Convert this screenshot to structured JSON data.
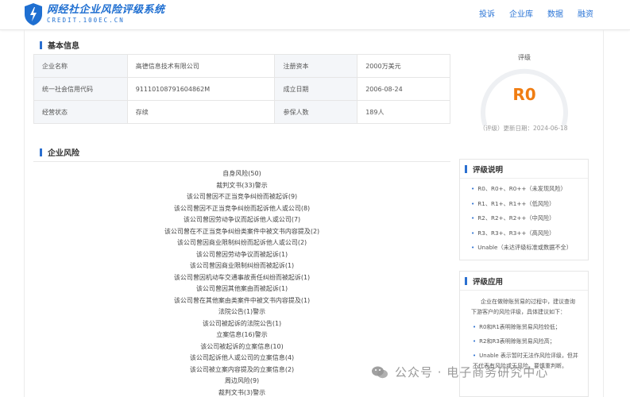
{
  "header": {
    "logo_main": "网经社企业风险评级系统",
    "logo_sub": "CREDIT.100EC.CN",
    "nav": [
      "投诉",
      "企业库",
      "数据",
      "融资"
    ]
  },
  "basic_info": {
    "title": "基本信息",
    "rows": [
      [
        "企业名称",
        "高德信息技术有限公司",
        "注册资本",
        "2000万美元"
      ],
      [
        "统一社会信用代码",
        "91110108791604862M",
        "成立日期",
        "2006-08-24"
      ],
      [
        "经营状态",
        "存续",
        "参保人数",
        "189人"
      ]
    ]
  },
  "rating": {
    "title": "评级",
    "value": "R0",
    "date_line": "（评级）更新日期：2024-06-18",
    "accent_color": "#f07d12"
  },
  "risk": {
    "title": "企业风险",
    "items": [
      "自身风险(50)",
      "裁判文书(33)警示",
      "该公司曾因不正当竞争纠纷而被起诉(9)",
      "该公司曾因不正当竞争纠纷而起诉他人或公司(8)",
      "该公司曾因劳动争议而起诉他人或公司(7)",
      "该公司曾在不正当竞争纠纷类案件中被文书内容提及(2)",
      "该公司曾因商业限制纠纷而起诉他人或公司(2)",
      "该公司曾因劳动争议而被起诉(1)",
      "该公司曾因商业限制纠纷而被起诉(1)",
      "该公司曾因机动车交通事故责任纠纷而被起诉(1)",
      "该公司曾因其他案由而被起诉(1)",
      "该公司曾在其他案由类案件中被文书内容提及(1)",
      "法院公告(1)警示",
      "该公司被起诉的法院公告(1)",
      "立案信息(16)警示",
      "该公司被起诉的立案信息(10)",
      "该公司起诉他人或公司的立案信息(4)",
      "该公司被立案内容提及的立案信息(2)",
      "周边风险(9)",
      "裁判文书(3)警示"
    ]
  },
  "grade_desc": {
    "title": "评级说明",
    "items": [
      "R0、R0+、R0++（未发现风险）",
      "R1、R1+、R1++（低风险）",
      "R2、R2+、R2++（中风险）",
      "R3、R3+、R3++（高风险）",
      "Unable（未达评级标准或数据不全）"
    ]
  },
  "grade_app": {
    "title": "评级应用",
    "intro": "企业在做赊账贸易的过程中，建议查询下游客户的风险评级，具体建议如下：",
    "items": [
      "R0和R1表明赊账贸易风险较低；",
      "R2和R3表明赊账贸易风险高；",
      "Unable 表示暂时无法作风险评级，但并不代表有风险或无风险，要慎重判断。"
    ]
  },
  "watermark": {
    "text": "公众号 · 电子商务研究中心"
  }
}
